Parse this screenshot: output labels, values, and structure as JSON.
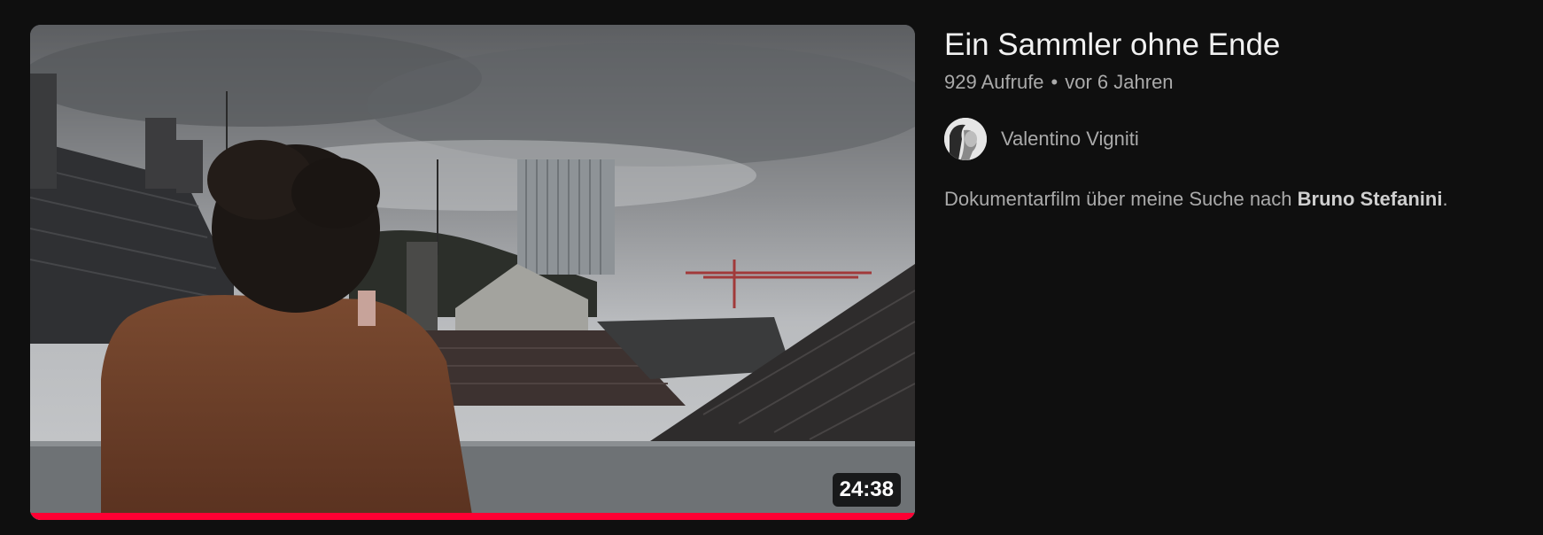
{
  "video": {
    "duration": "24:38",
    "watch_progress_fraction": 1.0,
    "title": "Ein Sammler ohne Ende",
    "views": "929 Aufrufe",
    "separator": "•",
    "age": "vor 6 Jahren",
    "channel_name": "Valentino Vigniti",
    "description_prefix": "Dokumentarfilm über meine Suche nach ",
    "description_bold": "Bruno Stefanini",
    "description_suffix": "."
  },
  "colors": {
    "background": "#0f0f0f",
    "progress": "#ff0033",
    "title_text": "#f1f1f1",
    "meta_text": "#aaaaaa"
  },
  "icons": {
    "thumbnail": "video-thumbnail-image",
    "avatar": "channel-avatar-image"
  }
}
